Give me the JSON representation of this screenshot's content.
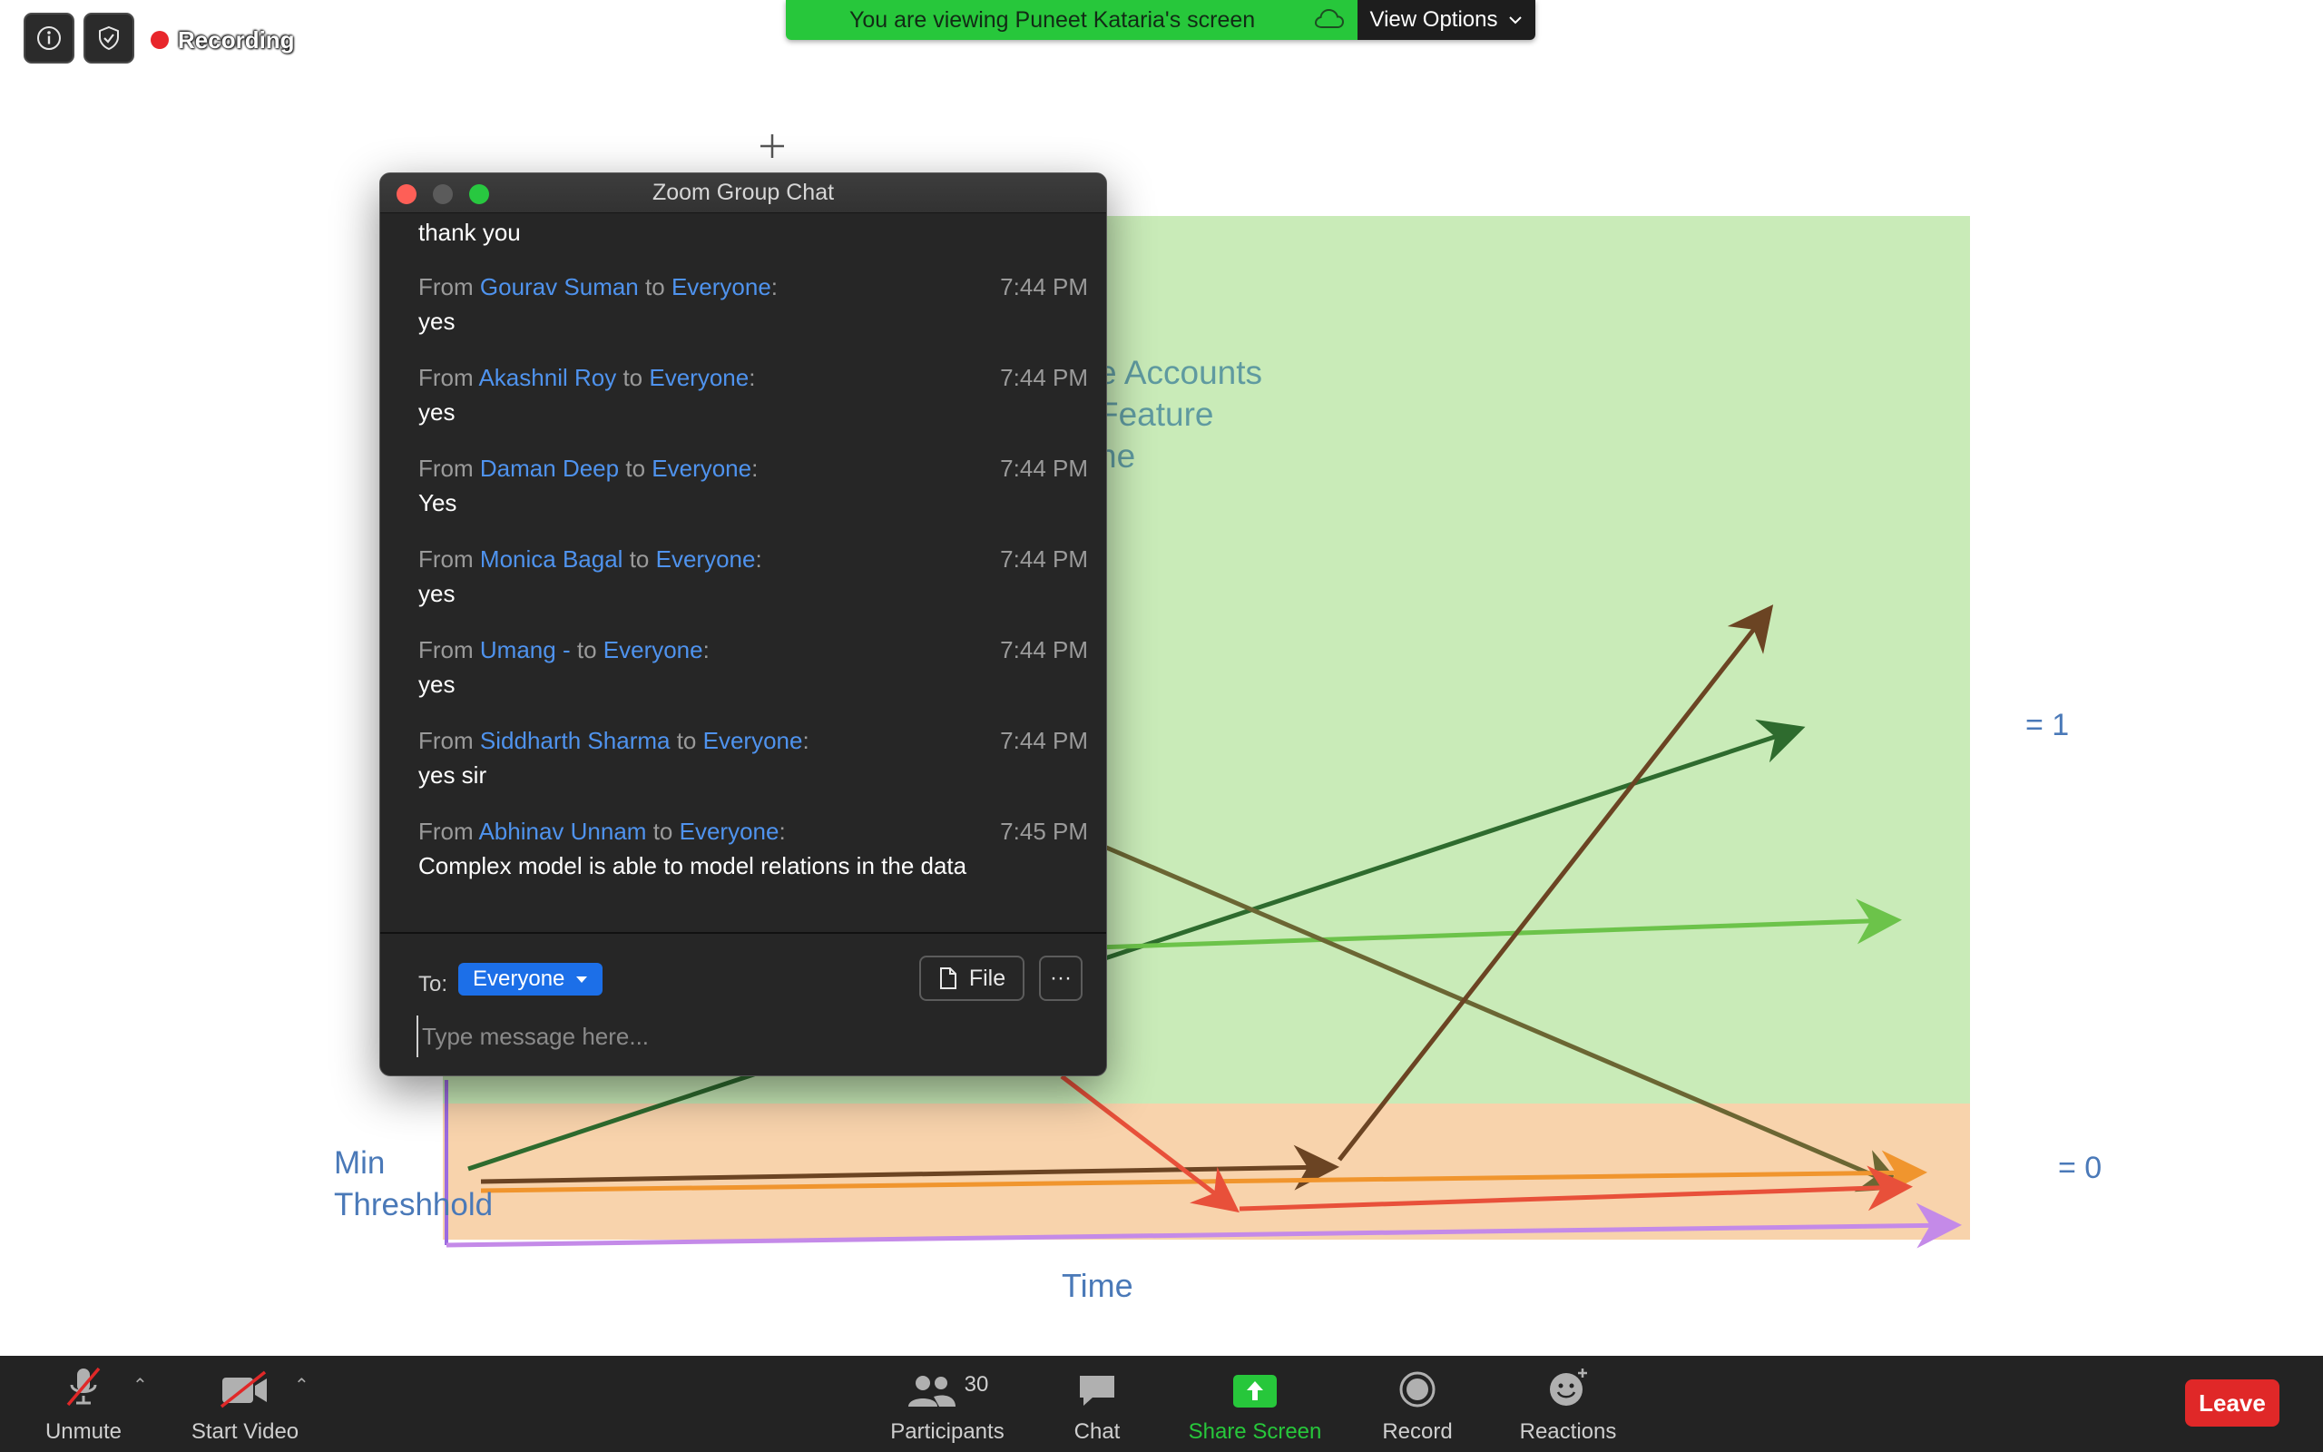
{
  "top_bar": {
    "recording_label": "Recording",
    "viewing_text": "You are viewing Puneet Kataria's screen",
    "view_options_label": "View Options"
  },
  "slide": {
    "legend_lines": [
      "e Accounts",
      "Feature",
      "ne"
    ],
    "label_eq_1": "= 1",
    "label_eq_0": "= 0",
    "min_line1": "Min",
    "min_line2": "Threshhold",
    "time_label": "Time",
    "colors": {
      "green_zone": "#c9ebb8",
      "orange_zone": "#f8d3ac",
      "brown": "#6b4423",
      "dark_green": "#2e6b2e",
      "light_green": "#6cc34a",
      "olive": "#6b6633",
      "red": "#e8503a",
      "orange": "#f0952e",
      "purple": "#c48ae8"
    }
  },
  "chat": {
    "title": "Zoom Group Chat",
    "first_line": "thank you",
    "from_word": "From",
    "to_word": "to",
    "messages": [
      {
        "sender": "Gourav Suman",
        "target": "Everyone",
        "time": "7:44 PM",
        "text": "yes"
      },
      {
        "sender": "Akashnil Roy",
        "target": "Everyone",
        "time": "7:44 PM",
        "text": "yes"
      },
      {
        "sender": "Daman Deep",
        "target": "Everyone",
        "time": "7:44 PM",
        "text": "Yes"
      },
      {
        "sender": "Monica Bagal",
        "target": "Everyone",
        "time": "7:44 PM",
        "text": "yes"
      },
      {
        "sender": "Umang -",
        "target": "Everyone",
        "time": "7:44 PM",
        "text": "yes"
      },
      {
        "sender": "Siddharth Sharma",
        "target": "Everyone",
        "time": "7:44 PM",
        "text": "yes sir"
      },
      {
        "sender": "Abhinav Unnam",
        "target": "Everyone",
        "time": "7:45 PM",
        "text": "Complex model is able to model relations in the data"
      }
    ],
    "compose": {
      "to_label": "To:",
      "recipient": "Everyone",
      "file_label": "File",
      "more_label": "···",
      "placeholder": "Type message here..."
    }
  },
  "toolbar": {
    "unmute_label": "Unmute",
    "start_video_label": "Start Video",
    "participants_label": "Participants",
    "participants_count": "30",
    "chat_label": "Chat",
    "share_screen_label": "Share Screen",
    "record_label": "Record",
    "reactions_label": "Reactions",
    "leave_label": "Leave",
    "share_color": "#27c73b",
    "leave_color": "#e02828"
  }
}
